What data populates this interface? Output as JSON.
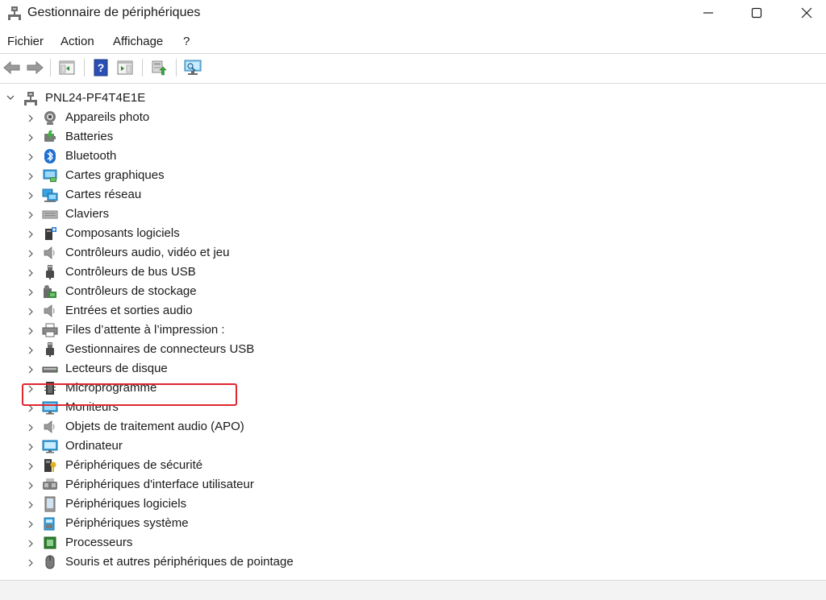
{
  "window": {
    "title": "Gestionnaire de périphériques"
  },
  "menu": {
    "file": "Fichier",
    "action": "Action",
    "view": "Affichage",
    "help": "?"
  },
  "toolbar": {
    "buttons": [
      "back-arrow-icon",
      "forward-arrow-icon",
      "properties-pane-icon",
      "help-icon",
      "console-tree-icon",
      "update-driver-icon",
      "scan-hardware-icon"
    ]
  },
  "tree": {
    "root": "PNL24-PF4T4E1E",
    "items": [
      {
        "label": "Appareils photo",
        "icon": "camera-icon"
      },
      {
        "label": "Batteries",
        "icon": "battery-icon"
      },
      {
        "label": "Bluetooth",
        "icon": "bluetooth-icon"
      },
      {
        "label": "Cartes graphiques",
        "icon": "display-adapter-icon"
      },
      {
        "label": "Cartes réseau",
        "icon": "network-adapter-icon"
      },
      {
        "label": "Claviers",
        "icon": "keyboard-icon"
      },
      {
        "label": "Composants logiciels",
        "icon": "software-component-icon"
      },
      {
        "label": "Contrôleurs audio, vidéo et jeu",
        "icon": "speaker-icon"
      },
      {
        "label": "Contrôleurs de bus USB",
        "icon": "usb-icon"
      },
      {
        "label": "Contrôleurs de stockage",
        "icon": "storage-controller-icon"
      },
      {
        "label": "Entrées et sorties audio",
        "icon": "speaker-icon"
      },
      {
        "label": "Files d’attente à l’impression :",
        "icon": "printer-icon"
      },
      {
        "label": "Gestionnaires de connecteurs USB",
        "icon": "usb-icon"
      },
      {
        "label": "Lecteurs de disque",
        "icon": "disk-drive-icon"
      },
      {
        "label": "Microprogramme",
        "icon": "firmware-icon"
      },
      {
        "label": "Moniteurs",
        "icon": "monitor-icon"
      },
      {
        "label": "Objets de traitement audio (APO)",
        "icon": "speaker-icon"
      },
      {
        "label": "Ordinateur",
        "icon": "computer-icon"
      },
      {
        "label": "Périphériques de sécurité",
        "icon": "security-device-icon"
      },
      {
        "label": "Périphériques d'interface utilisateur",
        "icon": "hid-icon"
      },
      {
        "label": "Périphériques logiciels",
        "icon": "software-device-icon"
      },
      {
        "label": "Périphériques système",
        "icon": "system-device-icon"
      },
      {
        "label": "Processeurs",
        "icon": "processor-icon"
      },
      {
        "label": "Souris et autres périphériques de pointage",
        "icon": "mouse-icon"
      }
    ]
  },
  "highlight": {
    "item": "Entrées et sorties audio",
    "color": "#e0262e"
  },
  "colors": {
    "accent": "#1f6fd1",
    "highlight": "#e0262e"
  }
}
